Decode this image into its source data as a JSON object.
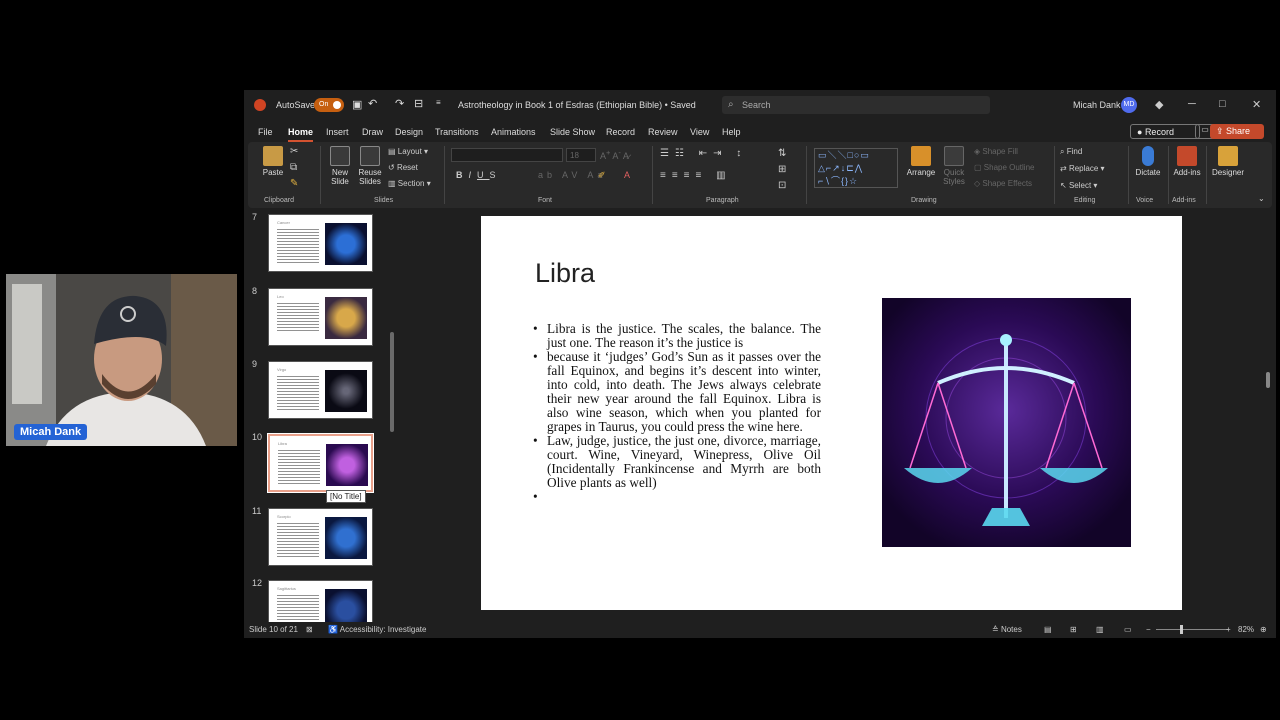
{
  "titlebar": {
    "autosave_label": "AutoSave",
    "autosave_state": "On",
    "doc_title": "Astrotheology in Book 1 of Esdras (Ethiopian Bible) • Saved",
    "search_placeholder": "Search",
    "user_name": "Micah Dank",
    "user_initials": "MD"
  },
  "tabs": [
    "File",
    "Home",
    "Insert",
    "Draw",
    "Design",
    "Transitions",
    "Animations",
    "Slide Show",
    "Record",
    "Review",
    "View",
    "Help"
  ],
  "tab_actions": {
    "record": "Record",
    "share": "Share"
  },
  "ribbon": {
    "clipboard": {
      "paste": "Paste",
      "label": "Clipboard"
    },
    "slides": {
      "new_slide_1": "New",
      "new_slide_2": "Slide",
      "reuse_1": "Reuse",
      "reuse_2": "Slides",
      "layout": "Layout",
      "reset": "Reset",
      "section": "Section",
      "label": "Slides"
    },
    "font": {
      "size": "18",
      "label": "Font"
    },
    "paragraph": {
      "label": "Paragraph"
    },
    "drawing": {
      "arrange": "Arrange",
      "quick_1": "Quick",
      "quick_2": "Styles",
      "shape_fill": "Shape Fill",
      "shape_outline": "Shape Outline",
      "shape_effects": "Shape Effects",
      "label": "Drawing"
    },
    "editing": {
      "find": "Find",
      "replace": "Replace",
      "select": "Select",
      "label": "Editing"
    },
    "voice": {
      "dictate": "Dictate",
      "label": "Voice"
    },
    "addins": {
      "addins": "Add-ins",
      "label": "Add-ins"
    },
    "designer": {
      "designer": "Designer"
    }
  },
  "thumbnails": [
    {
      "num": "7",
      "title": "Cancer"
    },
    {
      "num": "8",
      "title": "Leo"
    },
    {
      "num": "9",
      "title": "Virgo"
    },
    {
      "num": "10",
      "title": "Libra"
    },
    {
      "num": "11",
      "title": "Scorpio"
    },
    {
      "num": "12",
      "title": "Sagittarius"
    }
  ],
  "tooltip": "[No Title]",
  "slide": {
    "title": "Libra",
    "bullets": [
      "Libra is the justice. The scales, the balance. The just one. The reason it’s the justice is",
      "because it ‘judges’ God’s Sun as it passes over the fall Equinox, and begins it’s descent into winter, into cold, into death. The Jews always celebrate their new year around the fall Equinox. Libra is also wine season, which when you planted for grapes in Taurus, you could press the wine here.",
      "Law, judge, justice, the just one, divorce, marriage, court. Wine, Vineyard, Winepress, Olive Oil (Incidentally Frankincense and Myrrh are both Olive plants as well)",
      ""
    ]
  },
  "status": {
    "slide_counter": "Slide 10 of 21",
    "accessibility": "Accessibility: Investigate",
    "notes": "Notes",
    "zoom": "82%"
  },
  "webcam": {
    "name": "Micah Dank"
  },
  "colors": {
    "accent": "#d35230",
    "share": "#c4492b",
    "bg": "#1f1f1f"
  }
}
